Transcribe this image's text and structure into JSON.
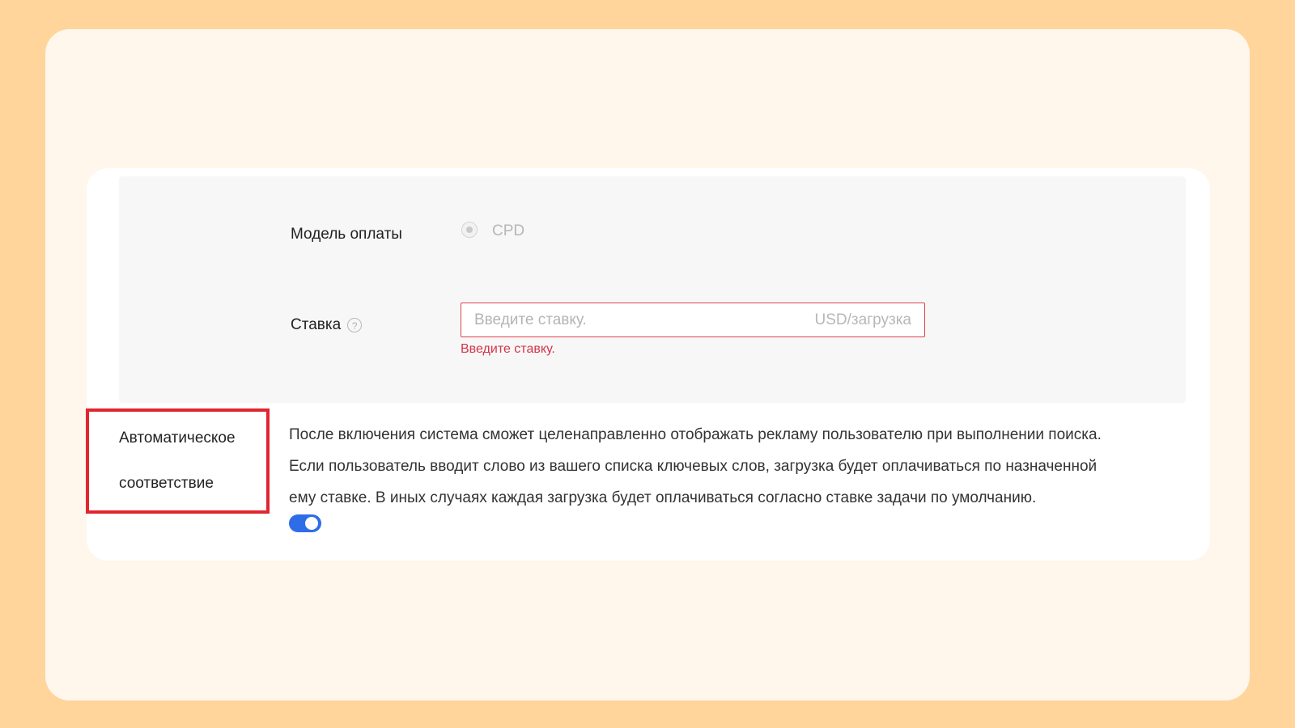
{
  "form": {
    "payment_model_label": "Модель оплаты",
    "payment_model_option": "CPD",
    "bid_label": "Ставка",
    "bid_help_icon": "question-circle-icon",
    "bid_placeholder": "Введите ставку.",
    "bid_unit": "USD/загрузка",
    "bid_error": "Введите ставку."
  },
  "auto_match": {
    "label_line1": "Автоматическое",
    "label_line2": "соответствие",
    "description": [
      "После включения система сможет целенаправленно отображать рекламу пользователю при выполнении поиска.",
      "Если пользователь вводит слово из вашего списка ключевых слов, загрузка будет оплачиваться по назначенной",
      "ему ставке. В иных случаях каждая загрузка будет оплачиваться согласно ставке задачи по умолчанию."
    ],
    "toggle_on": true
  },
  "colors": {
    "background": "#ffd59c",
    "outer_card": "#fff6ec",
    "error": "#d23548",
    "highlight": "#e1262f",
    "toggle": "#2f6de8"
  }
}
